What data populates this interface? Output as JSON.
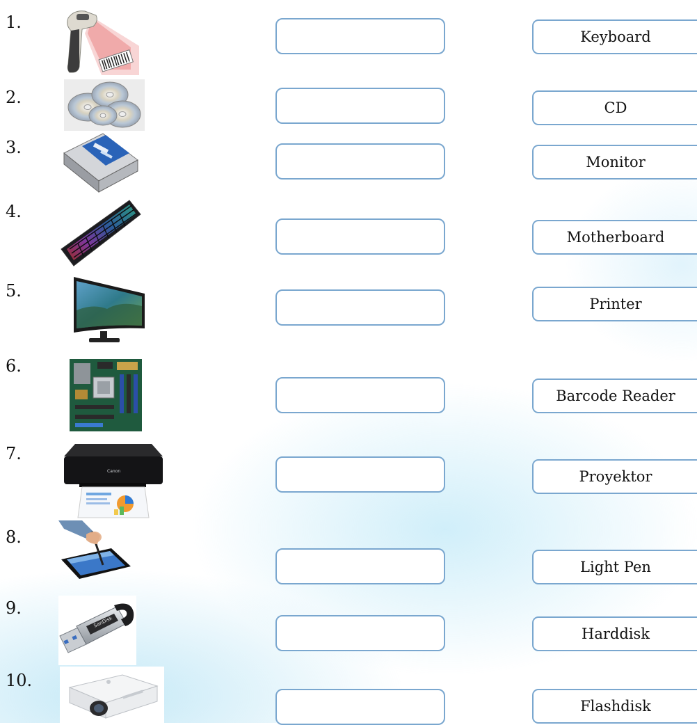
{
  "rows": [
    {
      "num": "1.",
      "answer_value": "",
      "label": "Keyboard"
    },
    {
      "num": "2.",
      "answer_value": "",
      "label": "CD"
    },
    {
      "num": "3.",
      "answer_value": "",
      "label": "Monitor"
    },
    {
      "num": "4.",
      "answer_value": "",
      "label": "Motherboard"
    },
    {
      "num": "5.",
      "answer_value": "",
      "label": "Printer"
    },
    {
      "num": "6.",
      "answer_value": "",
      "label": "Barcode Reader"
    },
    {
      "num": "7.",
      "answer_value": "",
      "label": "Proyektor"
    },
    {
      "num": "8.",
      "answer_value": "",
      "label": "Light Pen"
    },
    {
      "num": "9.",
      "answer_value": "",
      "label": "Harddisk"
    },
    {
      "num": "10.",
      "answer_value": "",
      "label": "Flashdisk"
    }
  ],
  "images": {
    "img1": "barcode-scanner-icon",
    "img2": "cd-discs-icon",
    "img3": "harddisk-icon",
    "img4": "keyboard-icon",
    "img5": "monitor-icon",
    "img6": "motherboard-icon",
    "img7": "printer-icon",
    "img8": "tablet-light-pen-icon",
    "img9": "flashdisk-icon",
    "img10": "projector-icon"
  },
  "brand_text": {
    "printer": "Canon",
    "flashdisk": "SanDisk"
  },
  "colors": {
    "box_border": "#7aa7cf",
    "background_tint": "#aee1f5"
  }
}
